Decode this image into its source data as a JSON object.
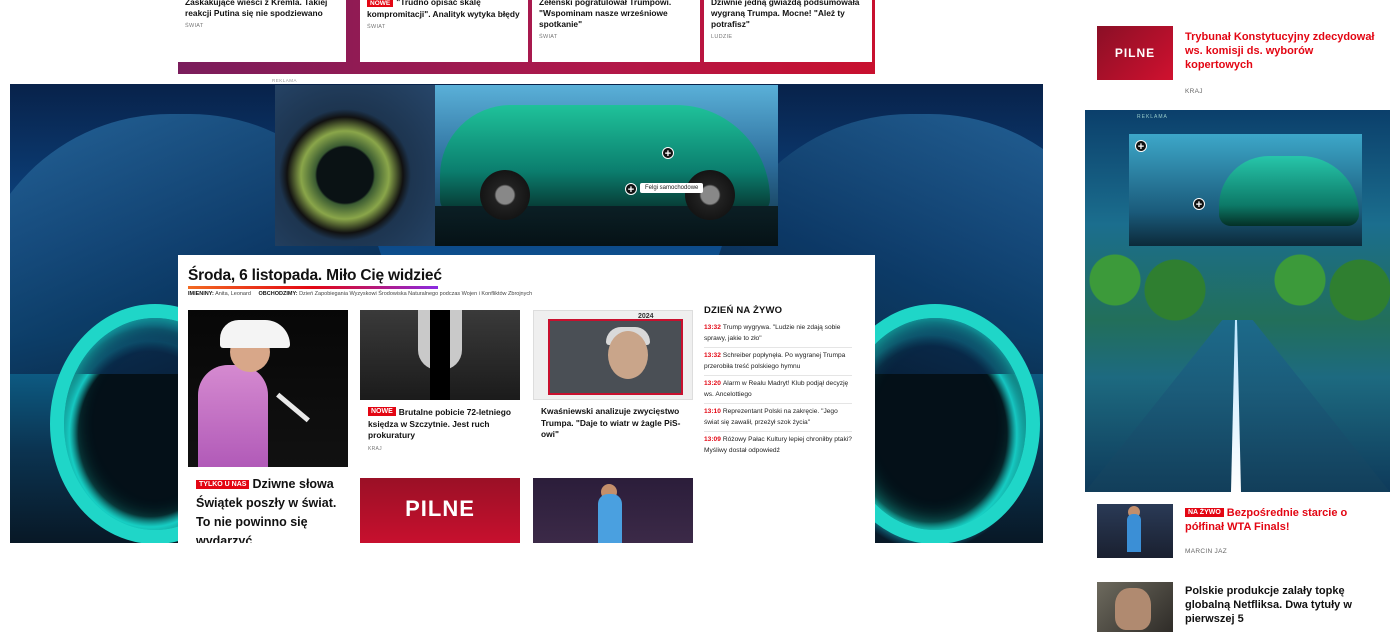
{
  "top_cards": [
    {
      "title": "Zaskakujące wieści z Kremla. Takiej reakcji Putina się nie spodziewano",
      "category": "ŚWIAT",
      "tag": ""
    },
    {
      "title": "\"Trudno opisać skalę kompromitacji\". Analityk wytyka błędy",
      "category": "ŚWIAT",
      "tag": "NOWE"
    },
    {
      "title": "Zełenski pogratulował Trumpowi. \"Wspominam nasze wrześniowe spotkanie\"",
      "category": "ŚWIAT",
      "tag": ""
    },
    {
      "title": "Dziwnie jedną gwiazdą podsumowała wygraną Trumpa. Mocne! \"Ależ ty potrafisz\"",
      "category": "LUDZIE",
      "tag": ""
    }
  ],
  "ad_small_label": "REKLAMA",
  "ad": {
    "tooltip": "Felgi samochodowe"
  },
  "greeting": {
    "title": "Środa, 6 listopada. Miło Cię widzieć",
    "imieniny_label": "IMIENINY:",
    "imieniny_value": "Anita, Leonard",
    "obchodzimy_label": "OBCHODZIMY:",
    "obchodzimy_value": "Dzień Zapobiegania Wyzyskowi Środowiska Naturalnego podczas Wojen i Konfliktów Zbrojnych"
  },
  "articles": {
    "main": {
      "tag": "TYLKO U NAS",
      "title": "Dziwne słowa Świątek poszły w świat. To nie powinno się wydarzyć"
    },
    "priest": {
      "tag": "NOWE",
      "title": "Brutalne pobicie 72-letniego księdza w Szczytnie. Jest ruch prokuratury",
      "category": "KRAJ"
    },
    "kwasniewski": {
      "title": "Kwaśniewski analizuje zwycięstwo Trumpa. \"Daje to wiatr w żagle PiS-owi\"",
      "badge": "2024"
    },
    "pilne_label": "PILNE"
  },
  "live": {
    "heading": "DZIEŃ NA ŻYWO",
    "items": [
      {
        "time": "13:32",
        "text": "Trump wygrywa. \"Ludzie nie zdają sobie sprawy, jakie to zło\""
      },
      {
        "time": "13:32",
        "text": "Schreiber popłynęła. Po wygranej Trumpa przerobiła treść polskiego hymnu"
      },
      {
        "time": "13:20",
        "text": "Alarm w Realu Madryt! Klub podjął decyzję ws. Ancelottiego"
      },
      {
        "time": "13:10",
        "text": "Reprezentant Polski na zakręcie. \"Jego świat się zawalił, przeżył szok życia\""
      },
      {
        "time": "13:09",
        "text": "Różowy Pałac Kultury lepiej chroniłby ptaki? Myśliwy dostał odpowiedź"
      }
    ]
  },
  "sidebar": {
    "pilne": {
      "thumb": "PILNE",
      "title": "Trybunał Konstytucyjny zdecydował ws. komisji ds. wyborów kopertowych",
      "category": "KRAJ"
    },
    "ad_label": "REKLAMA",
    "wta": {
      "tag": "NA ŻYWO",
      "title": "Bezpośrednie starcie o półfinał WTA Finals!",
      "author": "MARCIN JAZ"
    },
    "netflix": {
      "title": "Polskie produkcje zalały topkę globalną Netfliksa. Dwa tytuły w pierwszej 5"
    }
  },
  "colors": {
    "accent": "#e30613",
    "live_time": "#e30613",
    "strip": "#b0184a"
  }
}
